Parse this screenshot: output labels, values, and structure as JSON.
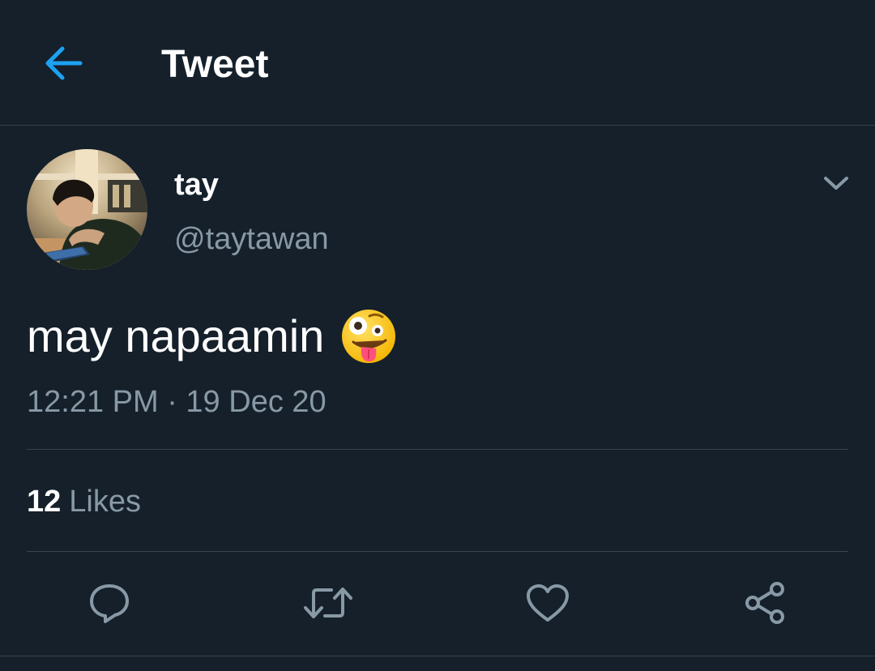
{
  "header": {
    "title": "Tweet",
    "back_icon": "arrow-left-icon"
  },
  "tweet": {
    "display_name": "tay",
    "handle": "@taytawan",
    "text": "may napaamin",
    "emoji": "zany-face-emoji",
    "timestamp": "12:21 PM · 19 Dec 20",
    "likes_count": "12",
    "likes_label": "Likes"
  },
  "actions": {
    "reply": "reply-icon",
    "retweet": "retweet-icon",
    "like": "heart-icon",
    "share": "share-icon"
  },
  "colors": {
    "background": "#15202b",
    "accent": "#1da1f2",
    "secondary_text": "#8899a6",
    "divider": "#38444d"
  }
}
